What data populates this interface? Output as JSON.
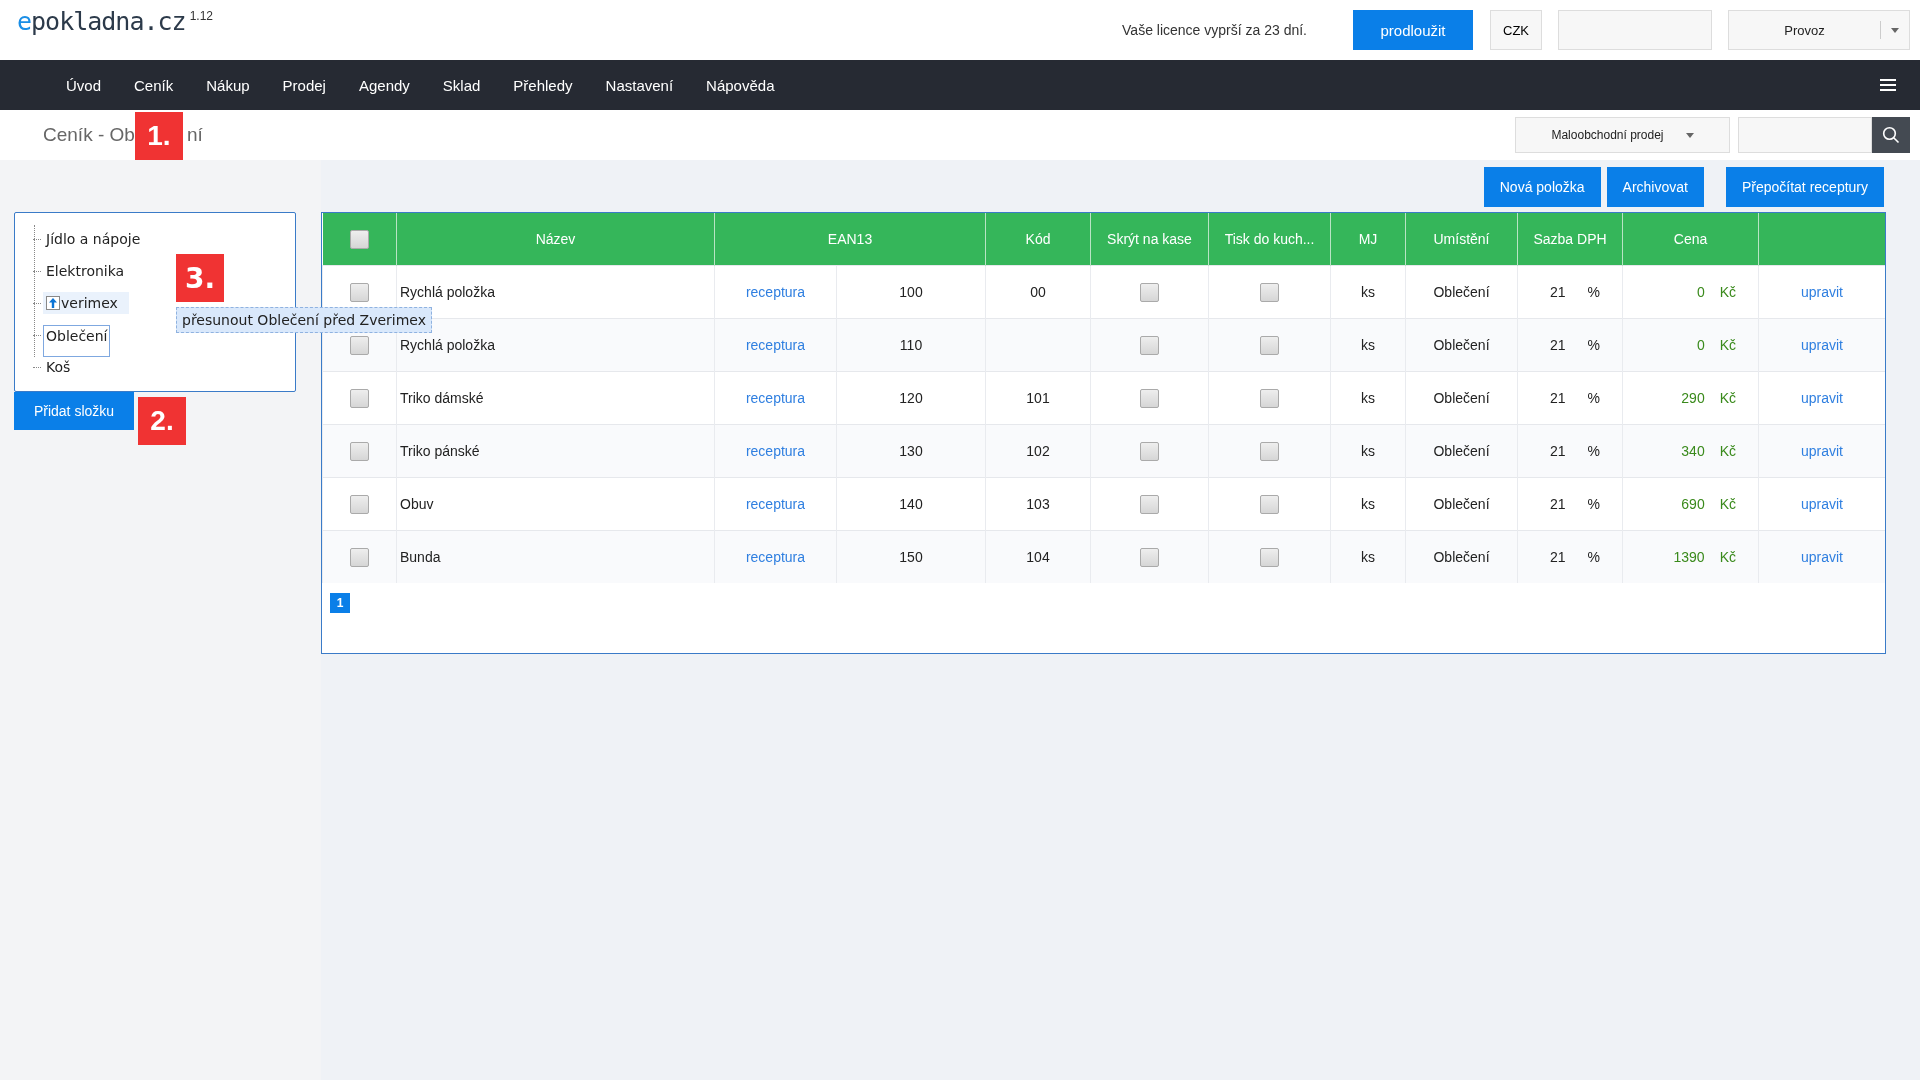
{
  "header": {
    "logo": {
      "accent": "e",
      "text": "pokladna.cz",
      "version": "1.12"
    },
    "license_notice": "Vaše licence vyprší za 23 dní.",
    "extend_button": "prodloužit",
    "currency": "CZK",
    "mode_select": "Provoz"
  },
  "nav": {
    "items": [
      {
        "label": "Úvod"
      },
      {
        "label": "Ceník"
      },
      {
        "label": "Nákup"
      },
      {
        "label": "Prodej"
      },
      {
        "label": "Agendy"
      },
      {
        "label": "Sklad"
      },
      {
        "label": "Přehledy"
      },
      {
        "label": "Nastavení"
      },
      {
        "label": "Nápověda"
      }
    ]
  },
  "subheader": {
    "title_start": "Ceník - Ob",
    "title_end": "ní",
    "sale_type_select": "Maloobchodní prodej"
  },
  "annotations": [
    {
      "label": "1."
    },
    {
      "label": "2."
    },
    {
      "label": "3."
    }
  ],
  "tree": {
    "items": [
      {
        "label": "Jídlo a nápoje",
        "selected": false,
        "drop_target": false
      },
      {
        "label": "Elektronika",
        "selected": false,
        "drop_target": false
      },
      {
        "label": "verimex",
        "selected": false,
        "drop_target": true
      },
      {
        "label": "Oblečení",
        "selected": true,
        "drop_target": false
      },
      {
        "label": "Koš",
        "selected": false,
        "drop_target": false
      }
    ],
    "tooltip": "přesunout Oblečení před Zverimex",
    "add_button": "Přidat složku"
  },
  "toolbar": {
    "buttons": [
      "Nová položka",
      "Archivovat",
      "Přepočítat receptury"
    ]
  },
  "table": {
    "select_all_checked": false,
    "columns": [
      {
        "label": "Název",
        "kind": "single"
      },
      {
        "label": "EAN13",
        "kind": "double"
      },
      {
        "label": "Kód",
        "kind": "single"
      },
      {
        "label": "Skrýt na kase",
        "kind": "single"
      },
      {
        "label": "Tisk do kuch...",
        "kind": "single"
      },
      {
        "label": "MJ",
        "kind": "single"
      },
      {
        "label": "Umístění",
        "kind": "single"
      },
      {
        "label": "Sazba DPH",
        "kind": "single"
      },
      {
        "label": "Cena",
        "kind": "single"
      }
    ],
    "rows": [
      {
        "checked": false,
        "name": "Rychlá položka",
        "recipe": "receptura",
        "ean": "100",
        "code": "00",
        "hidden": false,
        "kitchen": false,
        "unit": "ks",
        "location": "Oblečení",
        "vat": "21",
        "vat_unit": "%",
        "price": "0",
        "currency": "Kč",
        "edit": "upravit"
      },
      {
        "checked": false,
        "name": "Rychlá položka",
        "recipe": "receptura",
        "ean": "110",
        "hidden": false,
        "kitchen": false,
        "unit": "ks",
        "location": "Oblečení",
        "vat": "21",
        "vat_unit": "%",
        "price": "0",
        "currency": "Kč",
        "edit": "upravit"
      },
      {
        "checked": false,
        "name": "Triko dámské",
        "recipe": "receptura",
        "ean": "120",
        "code": "101",
        "hidden": false,
        "kitchen": false,
        "unit": "ks",
        "location": "Oblečení",
        "vat": "21",
        "vat_unit": "%",
        "price": "290",
        "currency": "Kč",
        "edit": "upravit"
      },
      {
        "checked": false,
        "name": "Triko pánské",
        "recipe": "receptura",
        "ean": "130",
        "code": "102",
        "hidden": false,
        "kitchen": false,
        "unit": "ks",
        "location": "Oblečení",
        "vat": "21",
        "vat_unit": "%",
        "price": "340",
        "currency": "Kč",
        "edit": "upravit"
      },
      {
        "checked": false,
        "name": "Obuv",
        "recipe": "receptura",
        "ean": "140",
        "code": "103",
        "hidden": false,
        "kitchen": false,
        "unit": "ks",
        "location": "Oblečení",
        "vat": "21",
        "vat_unit": "%",
        "price": "690",
        "currency": "Kč",
        "edit": "upravit"
      },
      {
        "checked": false,
        "name": "Bunda",
        "recipe": "receptura",
        "ean": "150",
        "code": "104",
        "hidden": false,
        "kitchen": false,
        "unit": "ks",
        "location": "Oblečení",
        "vat": "21",
        "vat_unit": "%",
        "price": "1390",
        "currency": "Kč",
        "edit": "upravit"
      }
    ],
    "pages": [
      {
        "label": "1",
        "selected": true
      }
    ]
  }
}
